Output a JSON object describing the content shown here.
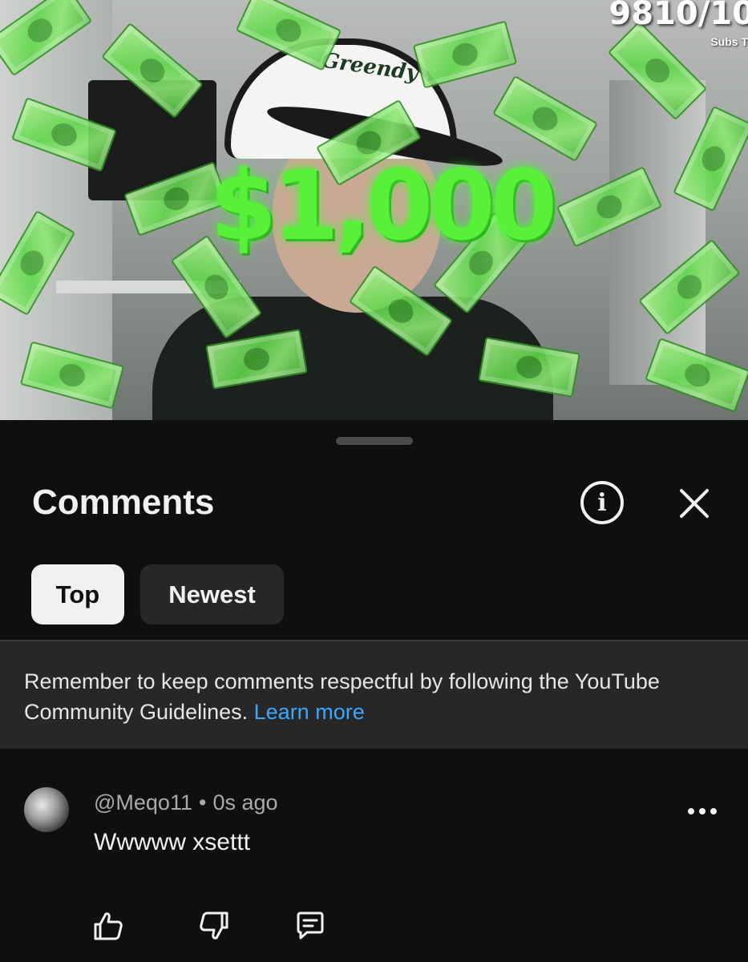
{
  "video": {
    "overlay_amount": "$1,000",
    "subscriber_counter": "9810/10",
    "subscriber_label": "Subs T",
    "cap_logo": "Greendy"
  },
  "comments_sheet": {
    "title": "Comments",
    "info_icon": "info-icon",
    "close_icon": "close-icon",
    "sort_chips": [
      {
        "label": "Top",
        "selected": true
      },
      {
        "label": "Newest",
        "selected": false
      }
    ],
    "guidelines_notice": {
      "text": "Remember to keep comments respectful by following the YouTube Community Guidelines.",
      "link_text": "Learn more"
    },
    "comments": [
      {
        "author": "@Meqo11",
        "separator": "•",
        "time": "0s ago",
        "text": "Wwwww xsettt",
        "actions": [
          "thumbs-up-icon",
          "thumbs-down-icon",
          "reply-icon"
        ]
      }
    ]
  },
  "colors": {
    "background": "#0f0f0f",
    "chip_selected_bg": "#f1f1f1",
    "chip_unselected_bg": "#272727",
    "notice_bg": "#272727",
    "link": "#3ea6ff",
    "money_green": "#59f03a"
  }
}
